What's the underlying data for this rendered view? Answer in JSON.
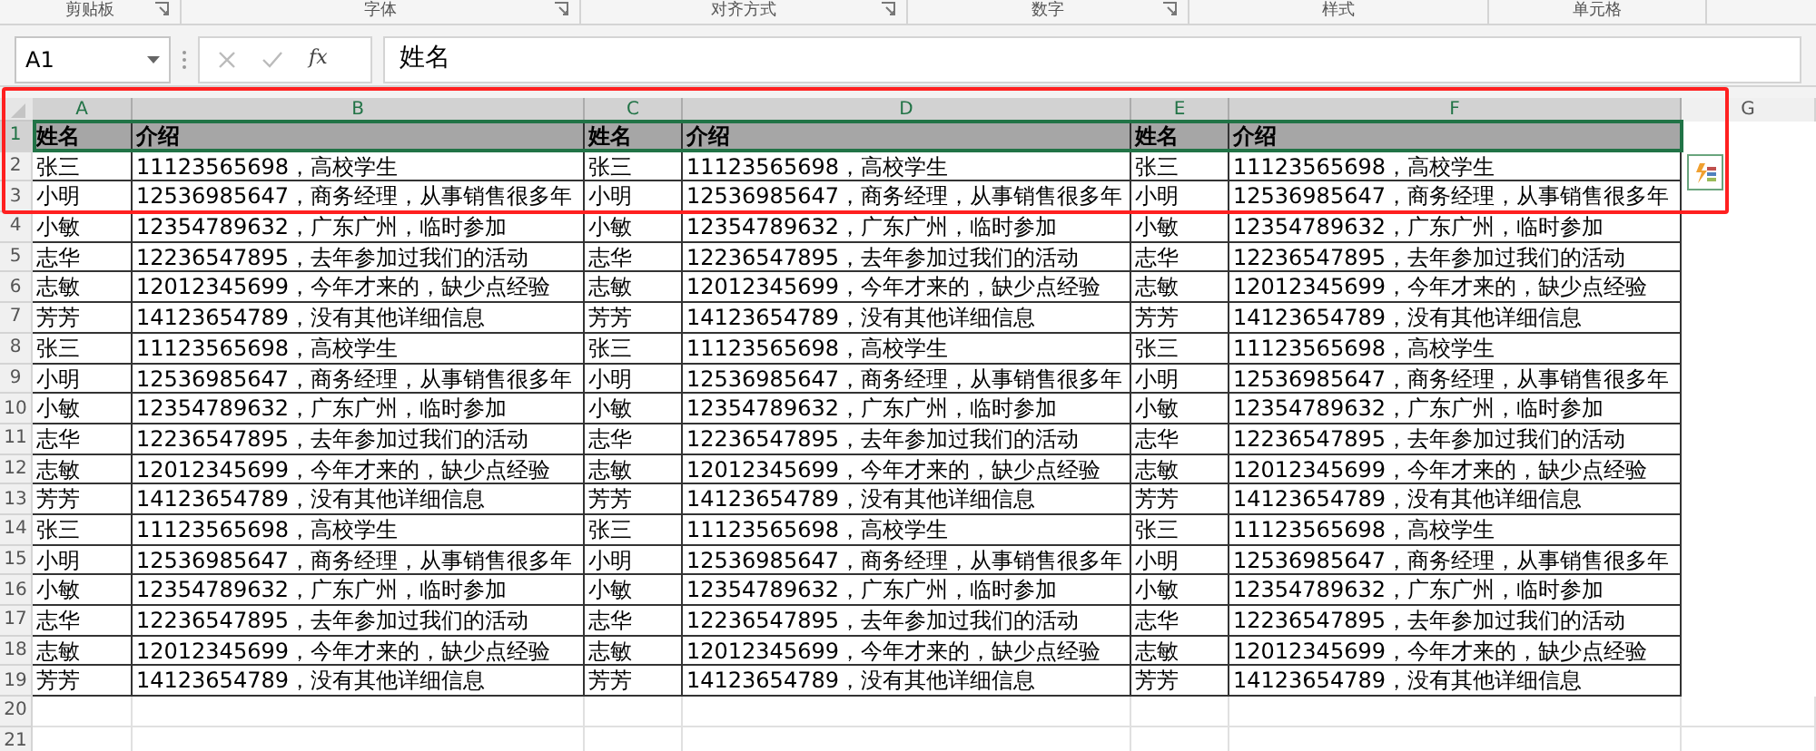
{
  "ribbon_groups": [
    "剪贴板",
    "字体",
    "对齐方式",
    "数字",
    "样式",
    "单元格"
  ],
  "formula_bar": {
    "name_box": "A1",
    "function_label": "fx",
    "value": "姓名"
  },
  "columns": [
    {
      "label": "A",
      "selected": true
    },
    {
      "label": "B",
      "selected": true
    },
    {
      "label": "C",
      "selected": true
    },
    {
      "label": "D",
      "selected": true
    },
    {
      "label": "E",
      "selected": true
    },
    {
      "label": "F",
      "selected": true
    },
    {
      "label": "G",
      "selected": false
    }
  ],
  "rows": [
    {
      "number": "1",
      "selected": true,
      "kind": "header",
      "cells": [
        "姓名",
        "介绍",
        "姓名",
        "介绍",
        "姓名",
        "介绍"
      ]
    },
    {
      "number": "2",
      "selected": false,
      "kind": "data",
      "cells": [
        "张三",
        "11123565698，高校学生",
        "张三",
        "11123565698，高校学生",
        "张三",
        "11123565698，高校学生"
      ]
    },
    {
      "number": "3",
      "selected": false,
      "kind": "data",
      "cells": [
        "小明",
        "12536985647，商务经理，从事销售很多年",
        "小明",
        "12536985647，商务经理，从事销售很多年",
        "小明",
        "12536985647，商务经理，从事销售很多年"
      ]
    },
    {
      "number": "4",
      "selected": false,
      "kind": "data",
      "cells": [
        "小敏",
        "12354789632，广东广州，临时参加",
        "小敏",
        "12354789632，广东广州，临时参加",
        "小敏",
        "12354789632，广东广州，临时参加"
      ]
    },
    {
      "number": "5",
      "selected": false,
      "kind": "data",
      "cells": [
        "志华",
        "12236547895，去年参加过我们的活动",
        "志华",
        "12236547895，去年参加过我们的活动",
        "志华",
        "12236547895，去年参加过我们的活动"
      ]
    },
    {
      "number": "6",
      "selected": false,
      "kind": "data",
      "cells": [
        "志敏",
        "12012345699，今年才来的，缺少点经验",
        "志敏",
        "12012345699，今年才来的，缺少点经验",
        "志敏",
        "12012345699，今年才来的，缺少点经验"
      ]
    },
    {
      "number": "7",
      "selected": false,
      "kind": "data",
      "cells": [
        "芳芳",
        "14123654789，没有其他详细信息",
        "芳芳",
        "14123654789，没有其他详细信息",
        "芳芳",
        "14123654789，没有其他详细信息"
      ]
    },
    {
      "number": "8",
      "selected": false,
      "kind": "data",
      "cells": [
        "张三",
        "11123565698，高校学生",
        "张三",
        "11123565698，高校学生",
        "张三",
        "11123565698，高校学生"
      ]
    },
    {
      "number": "9",
      "selected": false,
      "kind": "data",
      "cells": [
        "小明",
        "12536985647，商务经理，从事销售很多年",
        "小明",
        "12536985647，商务经理，从事销售很多年",
        "小明",
        "12536985647，商务经理，从事销售很多年"
      ]
    },
    {
      "number": "10",
      "selected": false,
      "kind": "data",
      "cells": [
        "小敏",
        "12354789632，广东广州，临时参加",
        "小敏",
        "12354789632，广东广州，临时参加",
        "小敏",
        "12354789632，广东广州，临时参加"
      ]
    },
    {
      "number": "11",
      "selected": false,
      "kind": "data",
      "cells": [
        "志华",
        "12236547895，去年参加过我们的活动",
        "志华",
        "12236547895，去年参加过我们的活动",
        "志华",
        "12236547895，去年参加过我们的活动"
      ]
    },
    {
      "number": "12",
      "selected": false,
      "kind": "data",
      "cells": [
        "志敏",
        "12012345699，今年才来的，缺少点经验",
        "志敏",
        "12012345699，今年才来的，缺少点经验",
        "志敏",
        "12012345699，今年才来的，缺少点经验"
      ]
    },
    {
      "number": "13",
      "selected": false,
      "kind": "data",
      "cells": [
        "芳芳",
        "14123654789，没有其他详细信息",
        "芳芳",
        "14123654789，没有其他详细信息",
        "芳芳",
        "14123654789，没有其他详细信息"
      ]
    },
    {
      "number": "14",
      "selected": false,
      "kind": "data",
      "cells": [
        "张三",
        "11123565698，高校学生",
        "张三",
        "11123565698，高校学生",
        "张三",
        "11123565698，高校学生"
      ]
    },
    {
      "number": "15",
      "selected": false,
      "kind": "data",
      "cells": [
        "小明",
        "12536985647，商务经理，从事销售很多年",
        "小明",
        "12536985647，商务经理，从事销售很多年",
        "小明",
        "12536985647，商务经理，从事销售很多年"
      ]
    },
    {
      "number": "16",
      "selected": false,
      "kind": "data",
      "cells": [
        "小敏",
        "12354789632，广东广州，临时参加",
        "小敏",
        "12354789632，广东广州，临时参加",
        "小敏",
        "12354789632，广东广州，临时参加"
      ]
    },
    {
      "number": "17",
      "selected": false,
      "kind": "data",
      "cells": [
        "志华",
        "12236547895，去年参加过我们的活动",
        "志华",
        "12236547895，去年参加过我们的活动",
        "志华",
        "12236547895，去年参加过我们的活动"
      ]
    },
    {
      "number": "18",
      "selected": false,
      "kind": "data",
      "cells": [
        "志敏",
        "12012345699，今年才来的，缺少点经验",
        "志敏",
        "12012345699，今年才来的，缺少点经验",
        "志敏",
        "12012345699，今年才来的，缺少点经验"
      ]
    },
    {
      "number": "19",
      "selected": false,
      "kind": "data",
      "cells": [
        "芳芳",
        "14123654789，没有其他详细信息",
        "芳芳",
        "14123654789，没有其他详细信息",
        "芳芳",
        "14123654789，没有其他详细信息"
      ]
    },
    {
      "number": "20",
      "selected": false,
      "kind": "empty",
      "cells": []
    },
    {
      "number": "21",
      "selected": false,
      "kind": "empty",
      "cells": []
    }
  ]
}
